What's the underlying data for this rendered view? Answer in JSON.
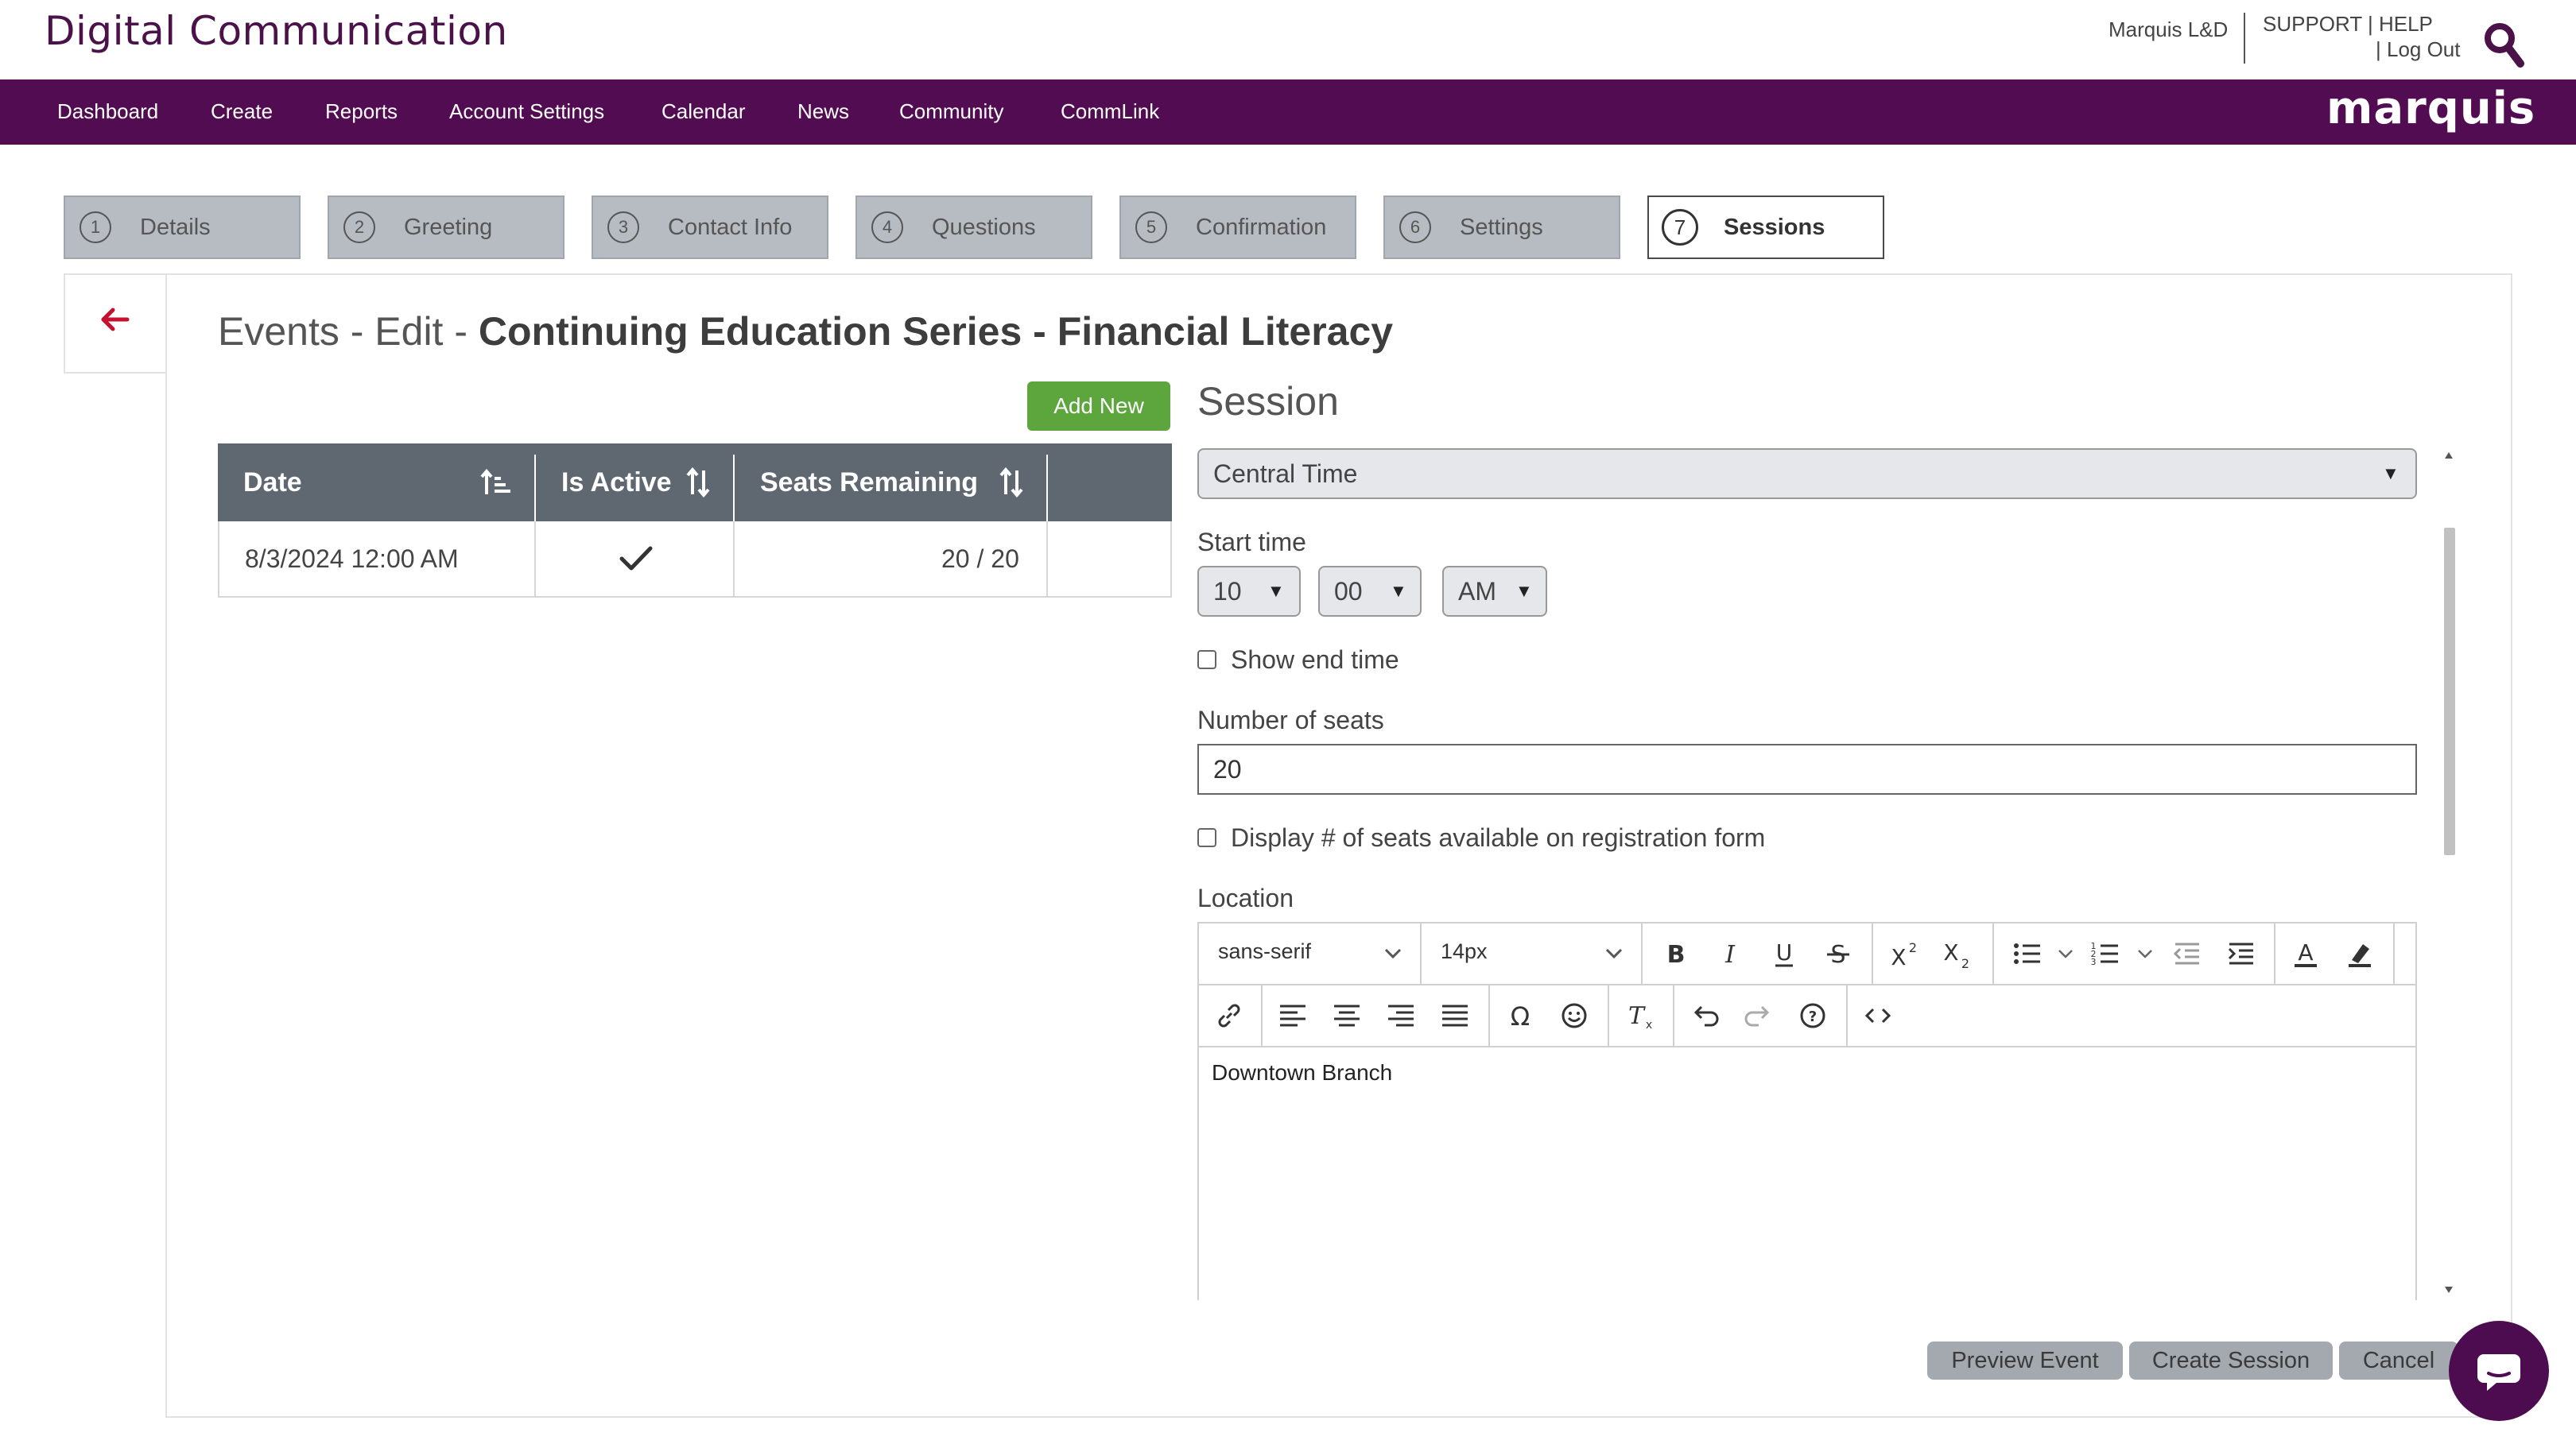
{
  "app": {
    "brand": "Digital Communication",
    "user": "Marquis L&D",
    "support": "SUPPORT",
    "help": "HELP",
    "logout": "Log Out",
    "logo": "marquis"
  },
  "nav": [
    "Dashboard",
    "Create",
    "Reports",
    "Account Settings",
    "Calendar",
    "News",
    "Community",
    "CommLink"
  ],
  "steps": [
    {
      "num": "1",
      "label": "Details"
    },
    {
      "num": "2",
      "label": "Greeting"
    },
    {
      "num": "3",
      "label": "Contact Info"
    },
    {
      "num": "4",
      "label": "Questions"
    },
    {
      "num": "5",
      "label": "Confirmation"
    },
    {
      "num": "6",
      "label": "Settings"
    },
    {
      "num": "7",
      "label": "Sessions"
    }
  ],
  "active_step": 7,
  "page": {
    "title_prefix": "Events - Edit - ",
    "event_name": "Continuing Education Series - Financial Literacy",
    "add_new": "Add New"
  },
  "table": {
    "columns": [
      "Date",
      "Is Active",
      "Seats Remaining"
    ],
    "rows": [
      {
        "date": "8/3/2024 12:00 AM",
        "is_active": true,
        "seats_remaining": "20 / 20"
      }
    ]
  },
  "session": {
    "title": "Session",
    "timezone": "Central Time",
    "start_time_label": "Start time",
    "hour": "10",
    "minute": "00",
    "ampm": "AM",
    "show_end_time_label": "Show end time",
    "show_end_time": false,
    "seats_label": "Number of seats",
    "seats_value": "20",
    "display_seats_label": "Display # of seats available on registration form",
    "display_seats": false,
    "location_label": "Location",
    "font_family": "sans-serif",
    "font_size": "14px",
    "location_text": "Downtown Branch"
  },
  "buttons": {
    "preview": "Preview Event",
    "create_session": "Create Session",
    "cancel": "Cancel"
  },
  "colors": {
    "brand_purple": "#520c52",
    "add_green": "#5da63d",
    "back_arrow_red": "#c8102e",
    "table_header": "#5f6770",
    "step_inactive": "#b7bcc3",
    "button_gray": "#a4a9b0"
  }
}
